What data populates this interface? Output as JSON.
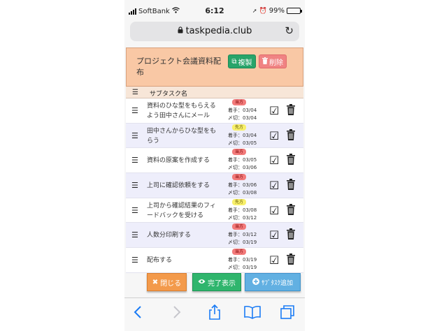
{
  "status_bar": {
    "carrier": "SoftBank",
    "time": "6:12",
    "battery": "99%"
  },
  "browser": {
    "url": "taskpedia.club"
  },
  "task": {
    "title": "プロジェクト会議資料配布",
    "copy_label": "複製",
    "delete_label": "削除"
  },
  "columns": {
    "subtask_name": "サブタスク名"
  },
  "labels": {
    "start_prefix": "着手：",
    "due_prefix": "〆切："
  },
  "subtasks": [
    {
      "name": "資料のひな型をもらえるよう田中さんにメール",
      "owner": "当方",
      "start": "03/04",
      "due": "03/04"
    },
    {
      "name": "田中さんからひな型をもらう",
      "owner": "先方",
      "start": "03/04",
      "due": "03/05"
    },
    {
      "name": "資料の原案を作成する",
      "owner": "当方",
      "start": "03/05",
      "due": "03/06"
    },
    {
      "name": "上司に確認依頼をする",
      "owner": "当方",
      "start": "03/06",
      "due": "03/08"
    },
    {
      "name": "上司から確認結果のフィードバックを受ける",
      "owner": "先方",
      "start": "03/08",
      "due": "03/12"
    },
    {
      "name": "人数分印刷する",
      "owner": "当方",
      "start": "03/12",
      "due": "03/19"
    },
    {
      "name": "配布する",
      "owner": "当方",
      "start": "03/19",
      "due": "03/19"
    }
  ],
  "footer": {
    "close_label": "閉じる",
    "show_done_label": "完了表示",
    "add_subtask_label": "ｻﾌﾞﾀｽｸ追加"
  },
  "colors": {
    "header_bg": "#f9c8a5",
    "copy_green": "#28a46a",
    "delete_pink": "#f08383",
    "close_orange": "#f39a4b",
    "show_green": "#2fb56d",
    "add_blue": "#62b0e2",
    "ios_blue": "#1a7bf5"
  },
  "icons": {
    "copy": "copy-icon",
    "delete": "trash-icon",
    "menu": "hamburger-icon",
    "check": "check-square-icon",
    "close": "x-icon",
    "eye": "eye-icon",
    "add": "plus-circle-icon"
  }
}
